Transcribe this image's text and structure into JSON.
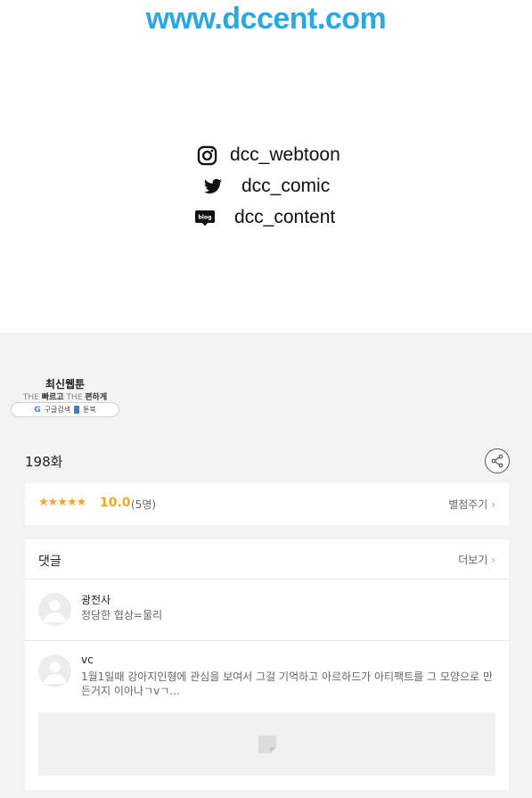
{
  "header": {
    "site_url": "www.dccent.com"
  },
  "social": [
    {
      "icon": "instagram-icon",
      "handle": "dcc_webtoon"
    },
    {
      "icon": "twitter-icon",
      "handle": "dcc_comic"
    },
    {
      "icon": "blog-icon",
      "handle": "dcc_content",
      "icon_text": "blog"
    }
  ],
  "badge": {
    "title": "최신웹툰",
    "subtitle_prefix1": "THE",
    "subtitle_word1": "빠르고",
    "subtitle_prefix2": "THE",
    "subtitle_word2": "편하게",
    "google": "G",
    "google_label": "구글검색",
    "toonbook_label": "툰북"
  },
  "episode": {
    "title": "198화"
  },
  "rating": {
    "stars": "★★★★★",
    "score": "10.0",
    "count": "(5명)",
    "rate_label": "별점주기",
    "chevron": "›"
  },
  "comments": {
    "title": "댓글",
    "more_label": "더보기",
    "chevron": "›",
    "items": [
      {
        "user": "광전사",
        "text": "정당한 협상=물리"
      },
      {
        "user": "vc",
        "text": "1월1일때 강아지인형에 관심을 보여서 그걸 기억하고 아르하드가 아티팩트를 그 모양으로 만든거지 이아나ㄱvㄱ..."
      }
    ]
  },
  "colors": {
    "accent_blue": "#29a9e1",
    "star": "#f5a623",
    "panel_bg": "#f3f3f3"
  }
}
